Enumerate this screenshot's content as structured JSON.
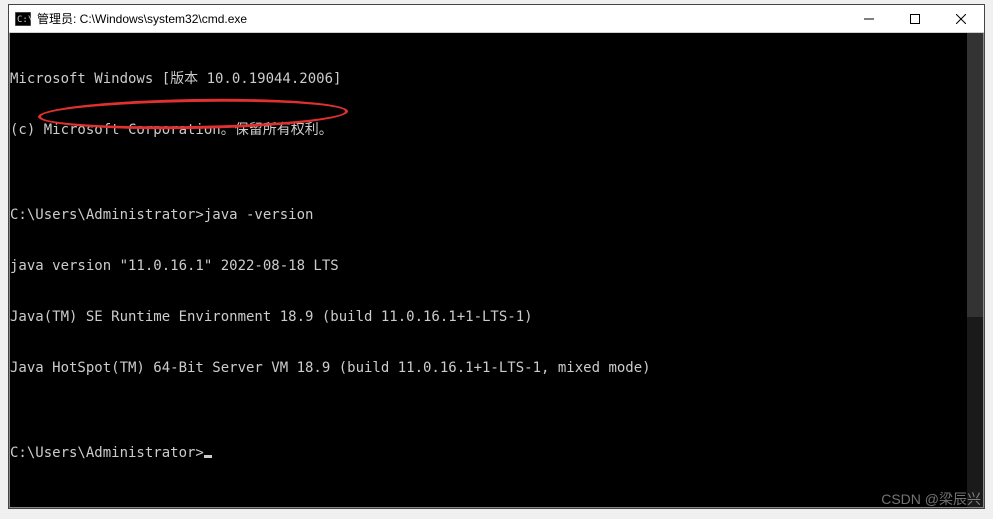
{
  "window": {
    "title": "管理员: C:\\Windows\\system32\\cmd.exe"
  },
  "terminal": {
    "lines": [
      "Microsoft Windows [版本 10.0.19044.2006]",
      "(c) Microsoft Corporation。保留所有权利。",
      "",
      "C:\\Users\\Administrator>java -version",
      "java version \"11.0.16.1\" 2022-08-18 LTS",
      "Java(TM) SE Runtime Environment 18.9 (build 11.0.16.1+1-LTS-1)",
      "Java HotSpot(TM) 64-Bit Server VM 18.9 (build 11.0.16.1+1-LTS-1, mixed mode)",
      "",
      "C:\\Users\\Administrator>"
    ],
    "prompt_index": 8
  },
  "annotation": {
    "highlighted_line_index": 4
  },
  "watermark": "CSDN @梁辰兴"
}
